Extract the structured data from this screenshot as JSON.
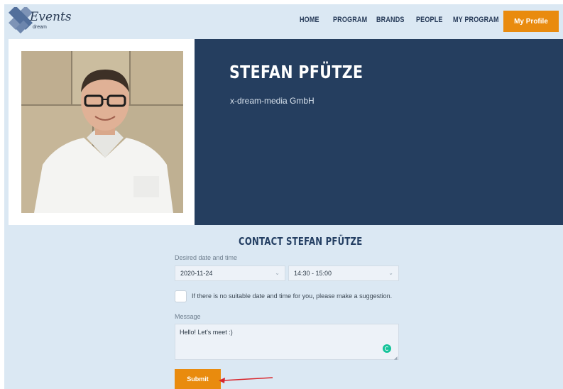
{
  "logo": {
    "word": "Events",
    "sub": "dream"
  },
  "nav": {
    "home": "HOME",
    "program": "PROGRAM",
    "brands": "BRANDS",
    "people": "PEOPLE",
    "my_program": "MY PROGRAM",
    "my_profile": "My Profile"
  },
  "profile": {
    "name": "STEFAN PFÜTZE",
    "company": "x-dream-media GmbH"
  },
  "contact": {
    "title": "CONTACT STEFAN PFÜTZE",
    "date_time_label": "Desired date and time",
    "date_value": "2020-11-24",
    "time_value": "14:30 - 15:00",
    "suggestion_text": "If there is no suitable date and time for you, please make a suggestion.",
    "message_label": "Message",
    "message_value": "Hello! Let's meet :)",
    "submit_label": "Submit"
  },
  "colors": {
    "accent": "#e98b0e",
    "navy": "#253e5f",
    "page_bg": "#dbe8f3",
    "annotation": "#d9262c"
  },
  "icons": [
    "logo-mark-icon",
    "chevron-down-icon",
    "grammarly-icon",
    "resize-handle-icon",
    "annotation-arrow-icon"
  ]
}
